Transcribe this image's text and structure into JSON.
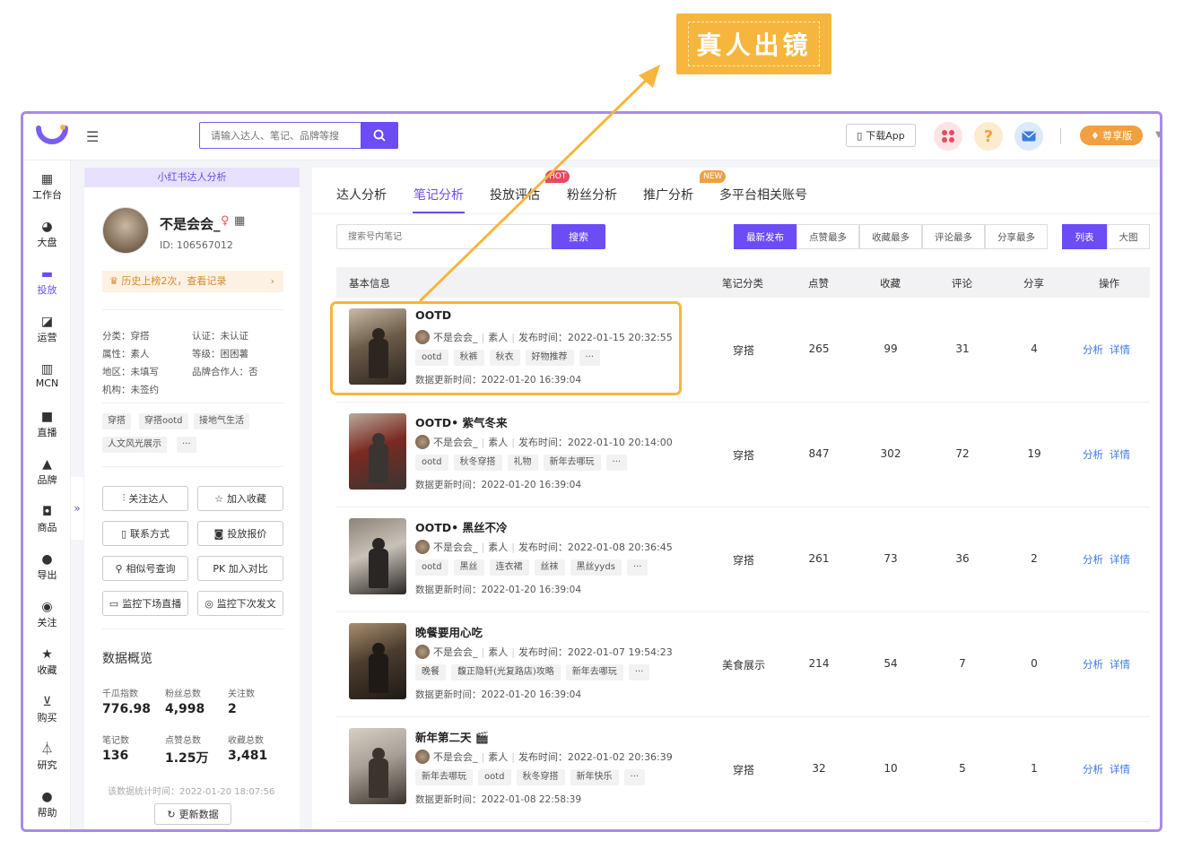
{
  "callout": {
    "text": "真人出镜"
  },
  "topbar": {
    "search_placeholder": "请输入达人、笔记、品牌等搜",
    "download_app": "下载App",
    "vip_label": "尊享版"
  },
  "leftnav": [
    {
      "label": "工作台",
      "icon": "grid-icon",
      "active": false
    },
    {
      "label": "大盘",
      "icon": "pie-icon",
      "active": false
    },
    {
      "label": "投放",
      "icon": "folder-icon",
      "active": true
    },
    {
      "label": "运营",
      "icon": "chart-icon",
      "active": false
    },
    {
      "label": "MCN",
      "icon": "building-icon",
      "active": false
    },
    {
      "label": "直播",
      "icon": "video-icon",
      "active": false
    },
    {
      "label": "品牌",
      "icon": "brand-icon",
      "active": false
    },
    {
      "label": "商品",
      "icon": "bag-icon",
      "active": false
    },
    {
      "label": "导出",
      "icon": "export-icon",
      "active": false
    },
    {
      "label": "关注",
      "icon": "eye-icon",
      "active": false
    },
    {
      "label": "收藏",
      "icon": "star-icon",
      "active": false
    },
    {
      "label": "购买",
      "icon": "cart-icon",
      "active": false
    },
    {
      "label": "研究",
      "icon": "flask-icon",
      "active": false
    },
    {
      "label": "帮助",
      "icon": "help-icon",
      "active": false
    }
  ],
  "profile": {
    "header": "小红书达人分析",
    "name": "不是会会_",
    "id": "ID: 106567012",
    "history": "历史上榜2次，查看记录",
    "attrs": [
      "分类：穿搭",
      "认证：未认证",
      "属性：素人",
      "等级：困困薯",
      "地区：未填写",
      "品牌合作人：否",
      "机构：未签约"
    ],
    "tags": [
      "穿搭",
      "穿搭ootd",
      "接地气生活",
      "人文风光展示",
      "···"
    ],
    "buttons": [
      "关注达人",
      "加入收藏",
      "联系方式",
      "投放报价",
      "相似号查询",
      "PK 加入对比",
      "监控下场直播",
      "监控下次发文"
    ],
    "overview_title": "数据概览",
    "stats": [
      {
        "label": "千瓜指数",
        "value": "776.98"
      },
      {
        "label": "粉丝总数",
        "value": "4,998"
      },
      {
        "label": "关注数",
        "value": "2"
      },
      {
        "label": "笔记数",
        "value": "136"
      },
      {
        "label": "点赞总数",
        "value": "1.25万"
      },
      {
        "label": "收藏总数",
        "value": "3,481"
      }
    ],
    "stat_time": "该数据统计时间：2022-01-20 18:07:56",
    "refresh": "更新数据"
  },
  "main": {
    "tabs": [
      "达人分析",
      "笔记分析",
      "投放评估",
      "粉丝分析",
      "推广分析",
      "多平台相关账号"
    ],
    "hot_badge": "HOT",
    "new_badge": "NEW",
    "search_placeholder": "搜索号内笔记",
    "search_btn": "搜索",
    "sort": [
      "最新发布",
      "点赞最多",
      "收藏最多",
      "评论最多",
      "分享最多"
    ],
    "view": [
      "列表",
      "大图"
    ],
    "columns": [
      "基本信息",
      "笔记分类",
      "点赞",
      "收藏",
      "评论",
      "分享",
      "操作"
    ],
    "rows": [
      {
        "title": "OOTD",
        "author": "不是会会_",
        "type": "素人",
        "time": "发布时间：2022-01-15 20:32:55",
        "tags": [
          "ootd",
          "秋裤",
          "秋衣",
          "好物推荐",
          "···"
        ],
        "updated": "数据更新时间：2022-01-20 16:39:04",
        "category": "穿搭",
        "likes": "265",
        "favs": "99",
        "comments": "31",
        "shares": "4"
      },
      {
        "title": "OOTD• 紫气冬来",
        "author": "不是会会_",
        "type": "素人",
        "time": "发布时间：2022-01-10 20:14:00",
        "tags": [
          "ootd",
          "秋冬穿搭",
          "礼物",
          "新年去哪玩",
          "···"
        ],
        "updated": "数据更新时间：2022-01-20 16:39:04",
        "category": "穿搭",
        "likes": "847",
        "favs": "302",
        "comments": "72",
        "shares": "19"
      },
      {
        "title": "OOTD• 黑丝不冷",
        "author": "不是会会_",
        "type": "素人",
        "time": "发布时间：2022-01-08 20:36:45",
        "tags": [
          "ootd",
          "黑丝",
          "连衣裙",
          "丝袜",
          "黑丝yyds",
          "···"
        ],
        "updated": "数据更新时间：2022-01-20 16:39:04",
        "category": "穿搭",
        "likes": "261",
        "favs": "73",
        "comments": "36",
        "shares": "2"
      },
      {
        "title": "晚餐要用心吃",
        "author": "不是会会_",
        "type": "素人",
        "time": "发布时间：2022-01-07 19:54:23",
        "tags": [
          "晚餐",
          "馥正隐轩(光复路店)攻略",
          "新年去哪玩",
          "···"
        ],
        "updated": "数据更新时间：2022-01-20 16:39:04",
        "category": "美食展示",
        "likes": "214",
        "favs": "54",
        "comments": "7",
        "shares": "0"
      },
      {
        "title": "新年第二天 🎬",
        "author": "不是会会_",
        "type": "素人",
        "time": "发布时间：2022-01-02 20:36:39",
        "tags": [
          "新年去哪玩",
          "ootd",
          "秋冬穿搭",
          "新年快乐",
          "···"
        ],
        "updated": "数据更新时间：2022-01-08 22:58:39",
        "category": "穿搭",
        "likes": "32",
        "favs": "10",
        "comments": "5",
        "shares": "1"
      }
    ],
    "op_analyze": "分析",
    "op_detail": "详情"
  },
  "colors": {
    "accent": "#6C4CF5",
    "callout": "#F6B63D",
    "link": "#3B7BE8",
    "frame": "#A88BE8"
  }
}
